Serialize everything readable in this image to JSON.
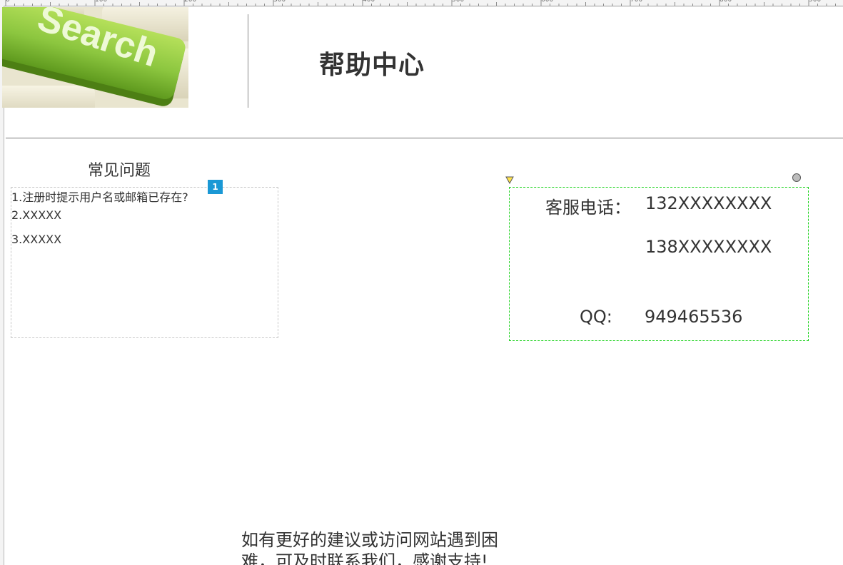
{
  "ruler": {
    "labels": [
      "0",
      "100",
      "200",
      "300",
      "400",
      "500",
      "600",
      "700",
      "800",
      "900"
    ]
  },
  "header": {
    "image_icon": "search-key-image",
    "image_text": "Search",
    "title": "帮助中心"
  },
  "faq": {
    "heading": "常见问题",
    "badge": "1",
    "items": [
      {
        "label": "1.注册时提示用户名或邮箱已存在?"
      },
      {
        "label": "2.XXXXX"
      },
      {
        "label": "3.XXXXX"
      }
    ]
  },
  "contact": {
    "phone_label": "客服电话：",
    "phone_1": "132XXXXXXXX",
    "phone_2": "138XXXXXXXX",
    "qq_label": "QQ:",
    "qq_value": "949465536"
  },
  "footer": {
    "text": "如有更好的建议或访问网站遇到困难，可及时联系我们，感谢支持!"
  },
  "colors": {
    "accent_green": "#8cc63f",
    "badge_blue": "#1a98d5",
    "contact_border": "#22d322"
  }
}
